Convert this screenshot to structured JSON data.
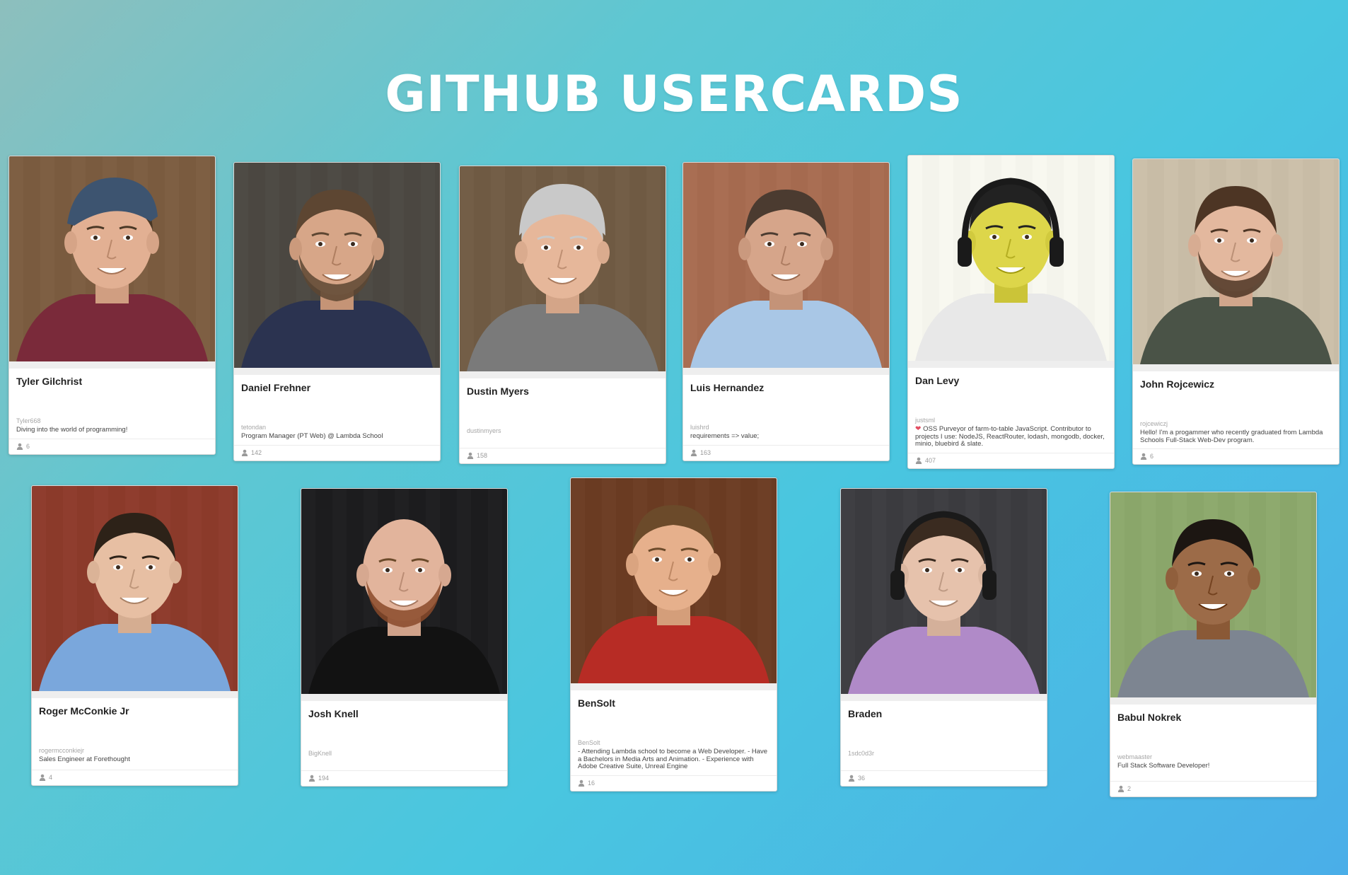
{
  "header": {
    "title": "GITHUB USERCARDS"
  },
  "cards": [
    {
      "name": "Tyler Gilchrist",
      "username": "Tyler668",
      "bio": "Diving into the world of programming!",
      "followers": "6",
      "photo": {
        "bg": "#7a5b3f",
        "skin": "#e2b093",
        "hair": "#4a3826",
        "shirt": "#7a2a3a",
        "accessory": "cap",
        "beard": false,
        "label": "Photo of Tyler Gilchrist"
      }
    },
    {
      "name": "Daniel Frehner",
      "username": "tetondan",
      "bio": "Program Manager (PT Web) @ Lambda School",
      "followers": "142",
      "photo": {
        "bg": "#4b4741",
        "skin": "#d7a688",
        "hair": "#5d4632",
        "shirt": "#2b3350",
        "accessory": "none",
        "beard": true,
        "label": "Photo of Daniel Frehner"
      }
    },
    {
      "name": "Dustin Myers",
      "username": "dustinmyers",
      "bio": "",
      "followers": "158",
      "photo": {
        "bg": "#6f5a43",
        "skin": "#e6b79a",
        "hair": "#c9c9c9",
        "shirt": "#7a7a7a",
        "accessory": "beanie",
        "beard": false,
        "label": "Photo of Dustin Myers"
      }
    },
    {
      "name": "Luis Hernandez",
      "username": "luishrd",
      "bio": "requirements => value;",
      "followers": "163",
      "photo": {
        "bg": "#a56a4f",
        "skin": "#d6a58a",
        "hair": "#4b3b30",
        "shirt": "#a9c7e6",
        "accessory": "none",
        "beard": false,
        "label": "Photo of Luis Hernandez"
      }
    },
    {
      "name": "Dan Levy",
      "username": "justsml",
      "bio": "OSS Purveyor of farm-to-table JavaScript. Contributor to projects I use: NodeJS, ReactRouter, lodash, mongodb, docker, minio, bluebird & slate.",
      "followers": "407",
      "photo": {
        "bg": "#f4f4ec",
        "skin": "#ddd64a",
        "hair": "#222222",
        "shirt": "#e8e8e8",
        "accessory": "headphones",
        "beard": false,
        "label": "Illustrated avatar of Dan Levy"
      }
    },
    {
      "name": "John Rojcewicz",
      "username": "rojcewiczj",
      "bio": "Hello! I'm a progammer who recently graduated from Lambda Schools Full-Stack Web-Dev program.",
      "followers": "6",
      "photo": {
        "bg": "#c8bca6",
        "skin": "#e3b89e",
        "hair": "#4d3524",
        "shirt": "#4a5347",
        "accessory": "none",
        "beard": true,
        "label": "Photo of John Rojcewicz"
      }
    },
    {
      "name": "Roger McConkie Jr",
      "username": "rogermcconkiejr",
      "bio": "Sales Engineer at Forethought",
      "followers": "4",
      "photo": {
        "bg": "#8b3a2a",
        "skin": "#e7bfa3",
        "hair": "#2d2218",
        "shirt": "#7aa7dc",
        "accessory": "none",
        "beard": false,
        "label": "Photo of Roger McConkie Jr"
      }
    },
    {
      "name": "Josh Knell",
      "username": "BigKnell",
      "bio": "",
      "followers": "194",
      "photo": {
        "bg": "#1c1c1e",
        "skin": "#e2b49c",
        "hair": "#e2b49c",
        "shirt": "#121212",
        "accessory": "none",
        "beard": true,
        "label": "Photo of Josh Knell"
      }
    },
    {
      "name": "BenSolt",
      "username": "BenSolt",
      "bio": "- Attending Lambda school to become a Web Developer. - Have a Bachelors in Media Arts and Animation. - Experience with Adobe Creative Suite, Unreal Engine",
      "followers": "16",
      "photo": {
        "bg": "#6a3b22",
        "skin": "#e6b08c",
        "hair": "#6b4a2a",
        "shirt": "#b72c25",
        "accessory": "none",
        "beard": false,
        "label": "Photo of BenSolt"
      }
    },
    {
      "name": "Braden",
      "username": "1sdc0d3r",
      "bio": "",
      "followers": "36",
      "photo": {
        "bg": "#3b3b3f",
        "skin": "#e6c2ac",
        "hair": "#3a2b20",
        "shirt": "#b08ac8",
        "accessory": "headphones",
        "beard": false,
        "label": "Photo of Braden"
      }
    },
    {
      "name": "Babul Nokrek",
      "username": "webmaaster",
      "bio": "Full Stack Software Developer!",
      "followers": "2",
      "photo": {
        "bg": "#8aa66a",
        "skin": "#9c6b48",
        "hair": "#1c1612",
        "shirt": "#7d8591",
        "accessory": "none",
        "beard": false,
        "label": "Photo of Babul Nokrek"
      }
    }
  ]
}
